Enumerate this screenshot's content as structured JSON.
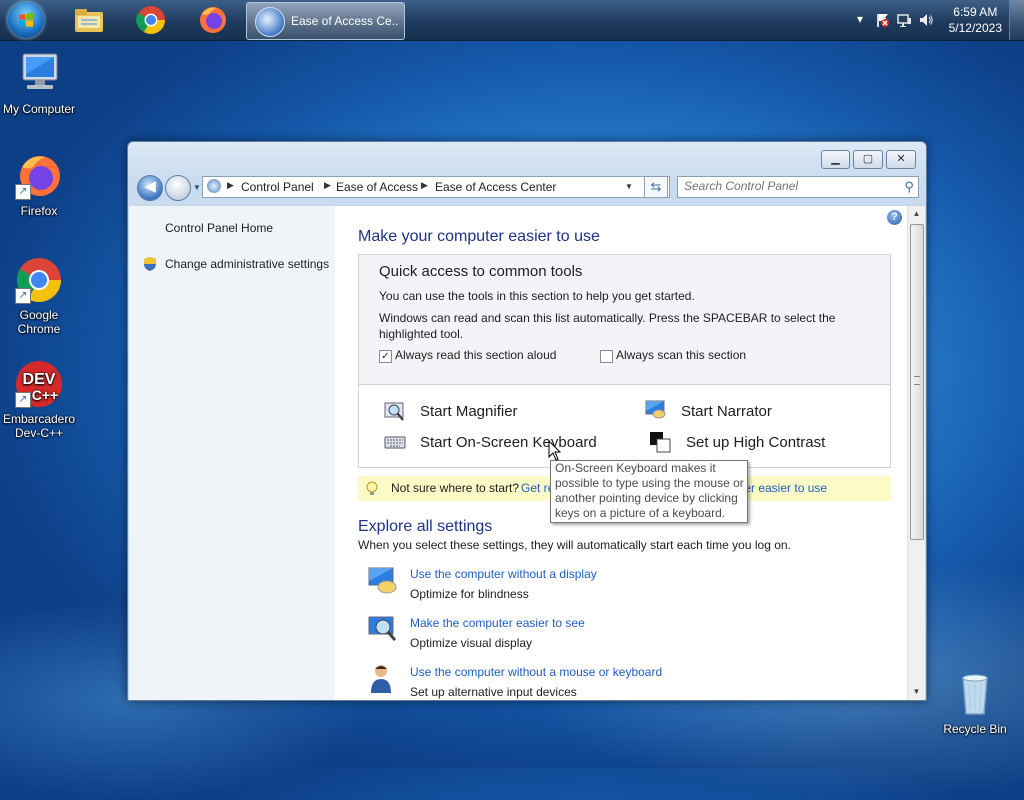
{
  "taskbar": {
    "pinned": [
      {
        "name": "start-button",
        "icon": "windows-logo-icon"
      },
      {
        "name": "explorer",
        "icon": "folder-icon"
      },
      {
        "name": "chrome",
        "icon": "chrome-icon"
      },
      {
        "name": "firefox",
        "icon": "firefox-icon"
      }
    ],
    "active_task": "Ease of Access Ce...",
    "clock_time": "6:59 AM",
    "clock_date": "5/12/2023",
    "tray_icons": [
      "chevron-up-icon",
      "action-center-flag-icon",
      "network-icon",
      "volume-icon"
    ]
  },
  "desktop": {
    "icons": [
      {
        "label": "My Computer"
      },
      {
        "label": "Firefox"
      },
      {
        "label": "Google Chrome"
      },
      {
        "label": "Embarcadero Dev-C++"
      },
      {
        "label": "Recycle Bin"
      }
    ],
    "devcpp_logo_text": "DEV",
    "devcpp_logo_sub": "C++"
  },
  "window": {
    "breadcrumbs": [
      "Control Panel",
      "Ease of Access",
      "Ease of Access Center"
    ],
    "search_placeholder": "Search Control Panel",
    "left_links": [
      "Control Panel Home",
      "Change administrative settings"
    ],
    "help_label": "?",
    "title": "Make your computer easier to use",
    "quick_access": {
      "title": "Quick access to common tools",
      "line1": "You can use the tools in this section to help you get started.",
      "line2": "Windows can read and scan this list automatically.  Press the SPACEBAR to select the highlighted tool.",
      "read_aloud_label": "Always read this section aloud",
      "read_aloud_checked": true,
      "scan_label": "Always scan this section",
      "scan_checked": false,
      "tools": [
        "Start Magnifier",
        "Start Narrator",
        "Start On-Screen Keyboard",
        "Set up High Contrast"
      ]
    },
    "tip": {
      "prefix": "Not sure where to start?",
      "link_start": "Get re",
      "link_end": "ter easier to use"
    },
    "explore": {
      "title": "Explore all settings",
      "desc": "When you select these settings, they will automatically start each time you log on.",
      "items": [
        {
          "link": "Use the computer without a display",
          "sub": "Optimize for blindness"
        },
        {
          "link": "Make the computer easier to see",
          "sub": "Optimize visual display"
        },
        {
          "link": "Use the computer without a mouse or keyboard",
          "sub": "Set up alternative input devices"
        }
      ]
    },
    "tooltip_lines": [
      "On-Screen Keyboard makes it",
      "possible to type using the mouse or",
      "another pointing device by clicking",
      "keys on a picture of a keyboard."
    ]
  }
}
